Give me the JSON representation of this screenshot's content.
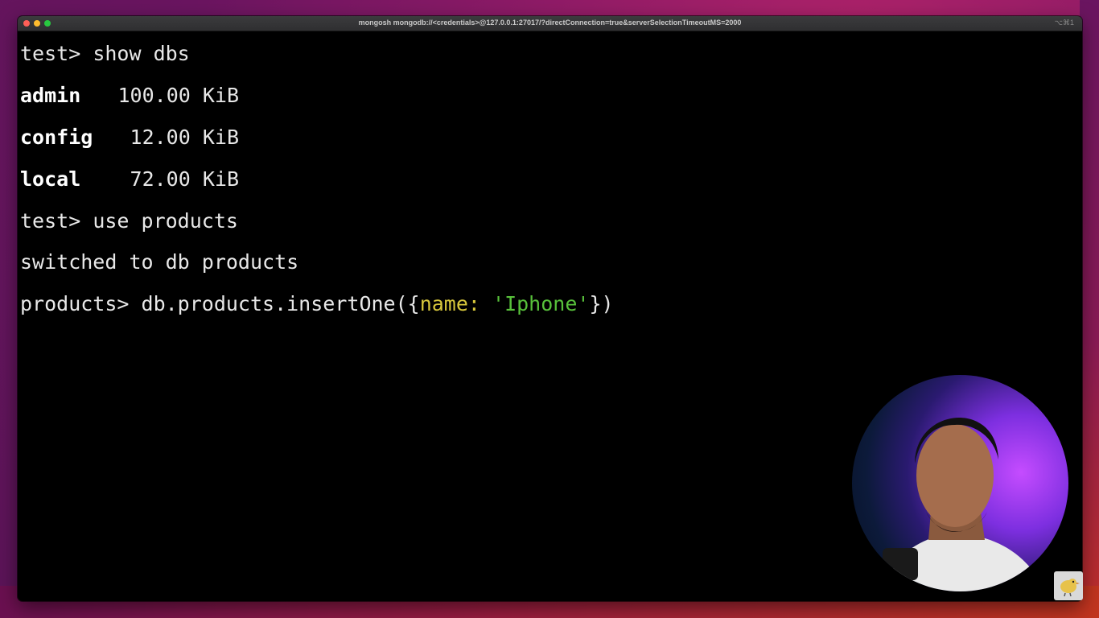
{
  "window": {
    "title": "mongosh mongodb://<credentials>@127.0.0.1:27017/?directConnection=true&serverSelectionTimeoutMS=2000",
    "shortcut": "⌥⌘1"
  },
  "terminal": {
    "line1": {
      "prompt": "test> ",
      "command": "show dbs"
    },
    "databases": [
      {
        "name": "admin",
        "size": "100.00 KiB"
      },
      {
        "name": "config",
        "size": "12.00 KiB"
      },
      {
        "name": "local",
        "size": "72.00 KiB"
      }
    ],
    "line5": {
      "prompt": "test> ",
      "command": "use products"
    },
    "line6": {
      "output": "switched to db products"
    },
    "line7": {
      "prompt": "products> ",
      "cmd_start": "db.products.insertOne({",
      "key": "name:",
      "space": " ",
      "value": "'Iphone'",
      "cmd_end": "})"
    }
  },
  "colors": {
    "key": "#d8c83c",
    "string": "#58c13b",
    "background": "#000000"
  },
  "icons": {
    "webcam": "webcam-overlay",
    "badge": "bird-logo-icon"
  }
}
